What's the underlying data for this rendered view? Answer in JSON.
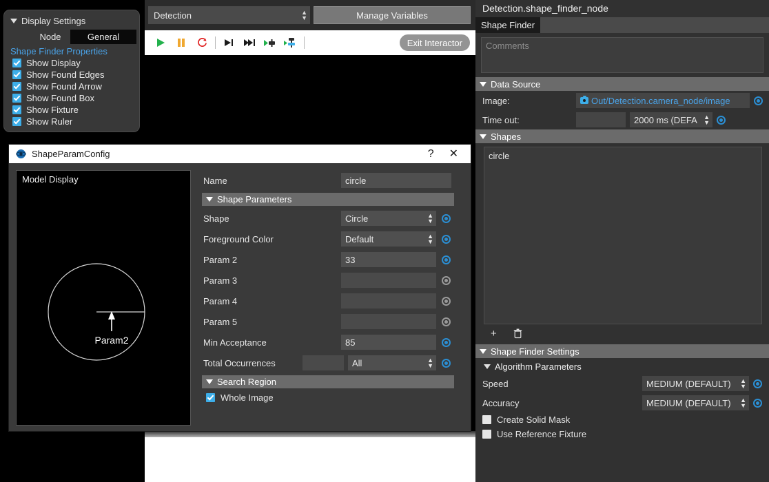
{
  "display_settings": {
    "title": "Display Settings",
    "tabs": [
      {
        "label": "Node",
        "selected": false
      },
      {
        "label": "General",
        "selected": true
      }
    ],
    "properties_header": "Shape Finder Properties",
    "checkboxes": [
      {
        "label": "Show Display",
        "checked": true
      },
      {
        "label": "Show Found Edges",
        "checked": true
      },
      {
        "label": "Show Found Arrow",
        "checked": true
      },
      {
        "label": "Show Found Box",
        "checked": true
      },
      {
        "label": "Show Fixture",
        "checked": true
      },
      {
        "label": "Show Ruler",
        "checked": true
      }
    ]
  },
  "toolbar": {
    "pipeline_combo": "Detection",
    "manage_variables_label": "Manage Variables",
    "exit_interactor_label": "Exit Interactor",
    "icons": [
      "play-icon",
      "pause-icon",
      "reload-icon",
      "step-forward-icon",
      "skip-forward-icon",
      "run-node-icon",
      "run-to-node-icon"
    ]
  },
  "right_panel": {
    "node_path": "Detection.shape_finder_node",
    "tab_label": "Shape Finder",
    "comments_placeholder": "Comments",
    "data_source": {
      "header": "Data Source",
      "image_label": "Image:",
      "image_value": "Out/Detection.camera_node/image",
      "timeout_label": "Time out:",
      "timeout_value": "",
      "timeout_unit": "2000 ms (DEFA"
    },
    "shapes": {
      "header": "Shapes",
      "items": [
        "circle"
      ],
      "add_label": "+",
      "delete_label": "delete-icon"
    },
    "settings": {
      "header": "Shape Finder Settings",
      "algorithm_header": "Algorithm Parameters",
      "speed_label": "Speed",
      "speed_value": "MEDIUM (DEFAULT)",
      "accuracy_label": "Accuracy",
      "accuracy_value": "MEDIUM (DEFAULT)",
      "create_solid_mask_label": "Create Solid Mask",
      "create_solid_mask_checked": false,
      "use_reference_fixture_label": "Use Reference Fixture",
      "use_reference_fixture_checked": false
    }
  },
  "dialog": {
    "title": "ShapeParamConfig",
    "help_label": "?",
    "close_label": "✕",
    "model_display_label": "Model Display",
    "model_annotation": "Param2",
    "name_label": "Name",
    "name_value": "circle",
    "shape_parameters_header": "Shape Parameters",
    "rows": [
      {
        "label": "Shape",
        "value": "Circle",
        "type": "combo",
        "radio": "active"
      },
      {
        "label": "Foreground Color",
        "value": "Default",
        "type": "combo",
        "radio": "active"
      },
      {
        "label": "Param 2",
        "value": "33",
        "type": "text",
        "radio": "active"
      },
      {
        "label": "Param 3",
        "value": "",
        "type": "text",
        "radio": "dim"
      },
      {
        "label": "Param 4",
        "value": "",
        "type": "text",
        "radio": "dim"
      },
      {
        "label": "Param 5",
        "value": "",
        "type": "text",
        "radio": "dim"
      },
      {
        "label": "Min Acceptance",
        "value": "85",
        "type": "text",
        "radio": "active"
      }
    ],
    "total_occurrences_label": "Total Occurrences",
    "total_occurrences_value": "",
    "total_occurrences_mode": "All",
    "search_region_header": "Search Region",
    "whole_image_label": "Whole Image",
    "whole_image_checked": true
  },
  "colors": {
    "accent_blue": "#3daee9",
    "link_blue": "#4aa3e8",
    "play_green": "#22b14c",
    "pause_orange": "#f0a830",
    "reload_red": "#e02020",
    "panel_bg": "#313131",
    "section_header": "#6b6b6b"
  }
}
